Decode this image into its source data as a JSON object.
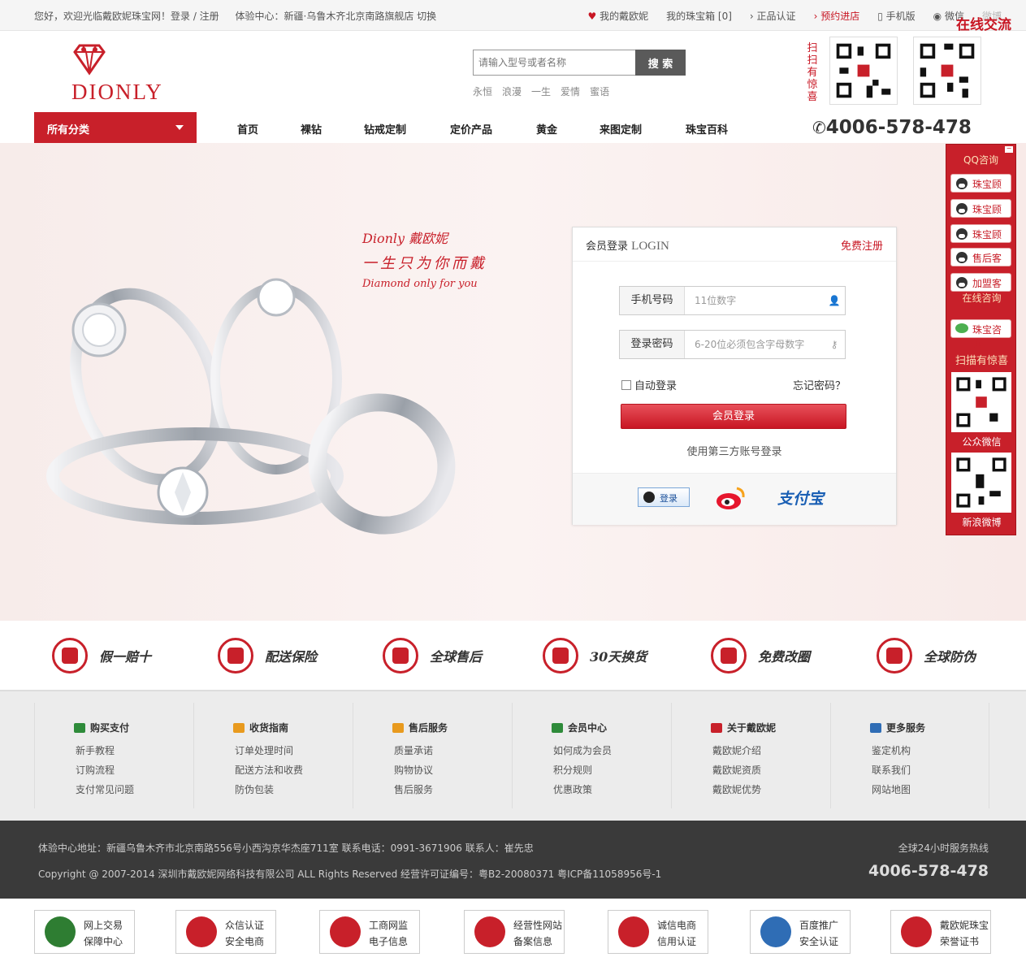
{
  "topbar": {
    "welcome": "您好，欢迎光临戴欧妮珠宝网！登录 / 注册",
    "experience": "体验中心：新疆·乌鲁木齐北京南路旗舰店 切换",
    "links": [
      "我的戴欧妮",
      "我的珠宝箱 [0]",
      "正品认证",
      "预约进店",
      "手机版",
      "微信",
      "微博"
    ],
    "online_tag": "在线交流"
  },
  "header": {
    "logo_text": "DIONLY",
    "search_placeholder": "请输入型号或者名称",
    "search_button": "搜 索",
    "hotwords": [
      "永恒",
      "浪漫",
      "一生",
      "爱情",
      "蜜语"
    ],
    "scan_text": "扫扫有惊喜"
  },
  "nav": {
    "all_categories": "所有分类",
    "links": [
      "首页",
      "裸钻",
      "钻戒定制",
      "定价产品",
      "黄金",
      "来图定制",
      "珠宝百科"
    ],
    "phone": "4006-578-478"
  },
  "banner": {
    "slogan_1": "Dionly 戴欧妮",
    "slogan_2": "一生只为你而戴",
    "slogan_3": "Diamond only for you"
  },
  "login": {
    "title": "会员登录",
    "title_en": "LOGIN",
    "register": "免费注册",
    "phone_label": "手机号码",
    "phone_placeholder": "11位数字",
    "pwd_label": "登录密码",
    "pwd_placeholder": "6-20位必须包含字母数字",
    "auto_login": "自动登录",
    "forget": "忘记密码？",
    "submit": "会员登录",
    "third_party": "使用第三方账号登录",
    "qq_login": "登录",
    "alipay": "支付宝"
  },
  "sidebar": {
    "qq_title": "QQ咨询",
    "buttons": [
      "珠宝顾问",
      "珠宝顾问",
      "珠宝顾问",
      "售后客服",
      "加盟客服"
    ],
    "online_title": "在线咨询",
    "online_button": "珠宝咨询",
    "scan": "扫描有惊喜",
    "wechat_label": "公众微信",
    "weibo_label": "新浪微博"
  },
  "services": [
    "假一赔十",
    "配送保险",
    "全球售后",
    "30天换货",
    "免费改圈",
    "全球防伪"
  ],
  "footer_columns": [
    {
      "title": "购买支付",
      "items": [
        "新手教程",
        "订购流程",
        "支付常见问题"
      ]
    },
    {
      "title": "收货指南",
      "items": [
        "订单处理时间",
        "配送方法和收费",
        "防伪包装"
      ]
    },
    {
      "title": "售后服务",
      "items": [
        "质量承诺",
        "购物协议",
        "售后服务"
      ]
    },
    {
      "title": "会员中心",
      "items": [
        "如何成为会员",
        "积分规则",
        "优惠政策"
      ]
    },
    {
      "title": "关于戴欧妮",
      "items": [
        "戴欧妮介绍",
        "戴欧妮资质",
        "戴欧妮优势"
      ]
    },
    {
      "title": "更多服务",
      "items": [
        "鉴定机构",
        "联系我们",
        "网站地图"
      ]
    }
  ],
  "copyright": {
    "address": "体验中心地址：新疆乌鲁木齐市北京南路556号小西沟京华杰座711室 联系电话：0991-3671906 联系人：崔先忠",
    "copyright": "Copyright @ 2007-2014 深圳市戴欧妮网络科技有限公司 ALL Rights Reserved 经营许可证编号：粤B2-20080371 粤ICP备11058956号-1",
    "hotline_label": "全球24小时服务热线",
    "hotline": "4006-578-478"
  },
  "badges": [
    {
      "l1": "网上交易",
      "l2": "保障中心",
      "color": "#2e7d32"
    },
    {
      "l1": "众信认证",
      "l2": "安全电商",
      "color": "#c8202a"
    },
    {
      "l1": "工商网监",
      "l2": "电子信息",
      "color": "#c8202a"
    },
    {
      "l1": "经营性网站",
      "l2": "备案信息",
      "color": "#c8202a"
    },
    {
      "l1": "诚信电商",
      "l2": "信用认证",
      "color": "#c8202a"
    },
    {
      "l1": "百度推广",
      "l2": "安全认证",
      "color": "#2f6db5"
    },
    {
      "l1": "戴欧妮珠宝",
      "l2": "荣誉证书",
      "color": "#c8202a"
    }
  ]
}
